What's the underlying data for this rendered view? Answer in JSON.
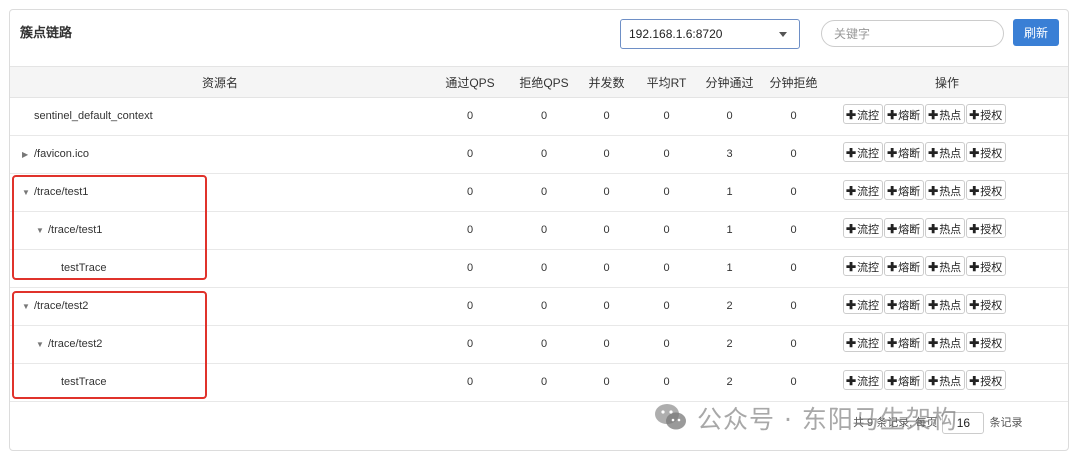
{
  "panel": {
    "title": "簇点链路"
  },
  "machine_select": {
    "value": "192.168.1.6:8720"
  },
  "search": {
    "placeholder": "关键字",
    "value": ""
  },
  "refresh_label": "刷新",
  "table": {
    "headers": [
      "资源名",
      "通过QPS",
      "拒绝QPS",
      "并发数",
      "平均RT",
      "分钟通过",
      "分钟拒绝",
      "操作"
    ],
    "rows": [
      {
        "name": "sentinel_default_context",
        "level": 0,
        "arrow": "",
        "pass_qps": "0",
        "block_qps": "0",
        "concurrency": "0",
        "avg_rt": "0",
        "minute_pass": "0",
        "minute_block": "0"
      },
      {
        "name": "/favicon.ico",
        "level": 0,
        "arrow": "▶",
        "pass_qps": "0",
        "block_qps": "0",
        "concurrency": "0",
        "avg_rt": "0",
        "minute_pass": "3",
        "minute_block": "0"
      },
      {
        "name": "/trace/test1",
        "level": 0,
        "arrow": "▼",
        "pass_qps": "0",
        "block_qps": "0",
        "concurrency": "0",
        "avg_rt": "0",
        "minute_pass": "1",
        "minute_block": "0"
      },
      {
        "name": "/trace/test1",
        "level": 1,
        "arrow": "▼",
        "pass_qps": "0",
        "block_qps": "0",
        "concurrency": "0",
        "avg_rt": "0",
        "minute_pass": "1",
        "minute_block": "0"
      },
      {
        "name": "testTrace",
        "level": 2,
        "arrow": "",
        "pass_qps": "0",
        "block_qps": "0",
        "concurrency": "0",
        "avg_rt": "0",
        "minute_pass": "1",
        "minute_block": "0"
      },
      {
        "name": "/trace/test2",
        "level": 0,
        "arrow": "▼",
        "pass_qps": "0",
        "block_qps": "0",
        "concurrency": "0",
        "avg_rt": "0",
        "minute_pass": "2",
        "minute_block": "0"
      },
      {
        "name": "/trace/test2",
        "level": 1,
        "arrow": "▼",
        "pass_qps": "0",
        "block_qps": "0",
        "concurrency": "0",
        "avg_rt": "0",
        "minute_pass": "2",
        "minute_block": "0"
      },
      {
        "name": "testTrace",
        "level": 2,
        "arrow": "",
        "pass_qps": "0",
        "block_qps": "0",
        "concurrency": "0",
        "avg_rt": "0",
        "minute_pass": "2",
        "minute_block": "0"
      }
    ],
    "actions": [
      "流控",
      "熔断",
      "热点",
      "授权"
    ]
  },
  "pagination": {
    "prefix": "共 9 条记录, 每页",
    "page_size": "16",
    "suffix": "条记录"
  },
  "watermark": "公众号 · 东阳马生架构",
  "colors": {
    "accent": "#3a7fd5",
    "highlight": "#e0322b"
  }
}
